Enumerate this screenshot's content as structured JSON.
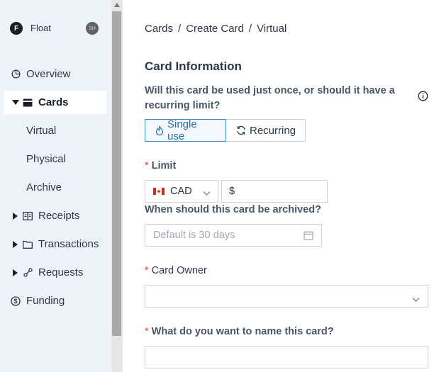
{
  "brand": {
    "logo_letter": "F",
    "name": "Float",
    "avatar_initials": "SH"
  },
  "sidebar": {
    "items": [
      {
        "label": "Overview",
        "icon": "pie-chart-icon"
      },
      {
        "label": "Cards",
        "icon": "card-icon",
        "active": true
      },
      {
        "label": "Receipts",
        "icon": "receipt-icon"
      },
      {
        "label": "Transactions",
        "icon": "folder-icon"
      },
      {
        "label": "Requests",
        "icon": "link-icon"
      },
      {
        "label": "Funding",
        "icon": "dollar-circle-icon"
      }
    ],
    "card_subitems": [
      "Virtual",
      "Physical",
      "Archive"
    ]
  },
  "breadcrumb": {
    "items": [
      "Cards",
      "Create Card",
      "Virtual"
    ],
    "separator": "/"
  },
  "form": {
    "section_title": "Card Information",
    "usage_question": "Will this card be used just once, or should it have a recurring limit?",
    "usage_options": [
      {
        "label": "Single use",
        "icon": "flame-icon",
        "selected": true
      },
      {
        "label": "Recurring",
        "icon": "refresh-icon",
        "selected": false
      }
    ],
    "limit_label": "Limit",
    "required_marker": "*",
    "currency": {
      "code": "CAD",
      "flag": "canada-flag-icon"
    },
    "amount_prefix": "$",
    "archive_question": "When should this card be archived?",
    "archive_placeholder": "Default is 30 days",
    "owner_label": "Card Owner",
    "name_question": "What do you want to name this card?"
  },
  "colors": {
    "accent": "#3b8ec8",
    "required": "#e53e3e",
    "sidebar_bg": "#eef3fa"
  }
}
